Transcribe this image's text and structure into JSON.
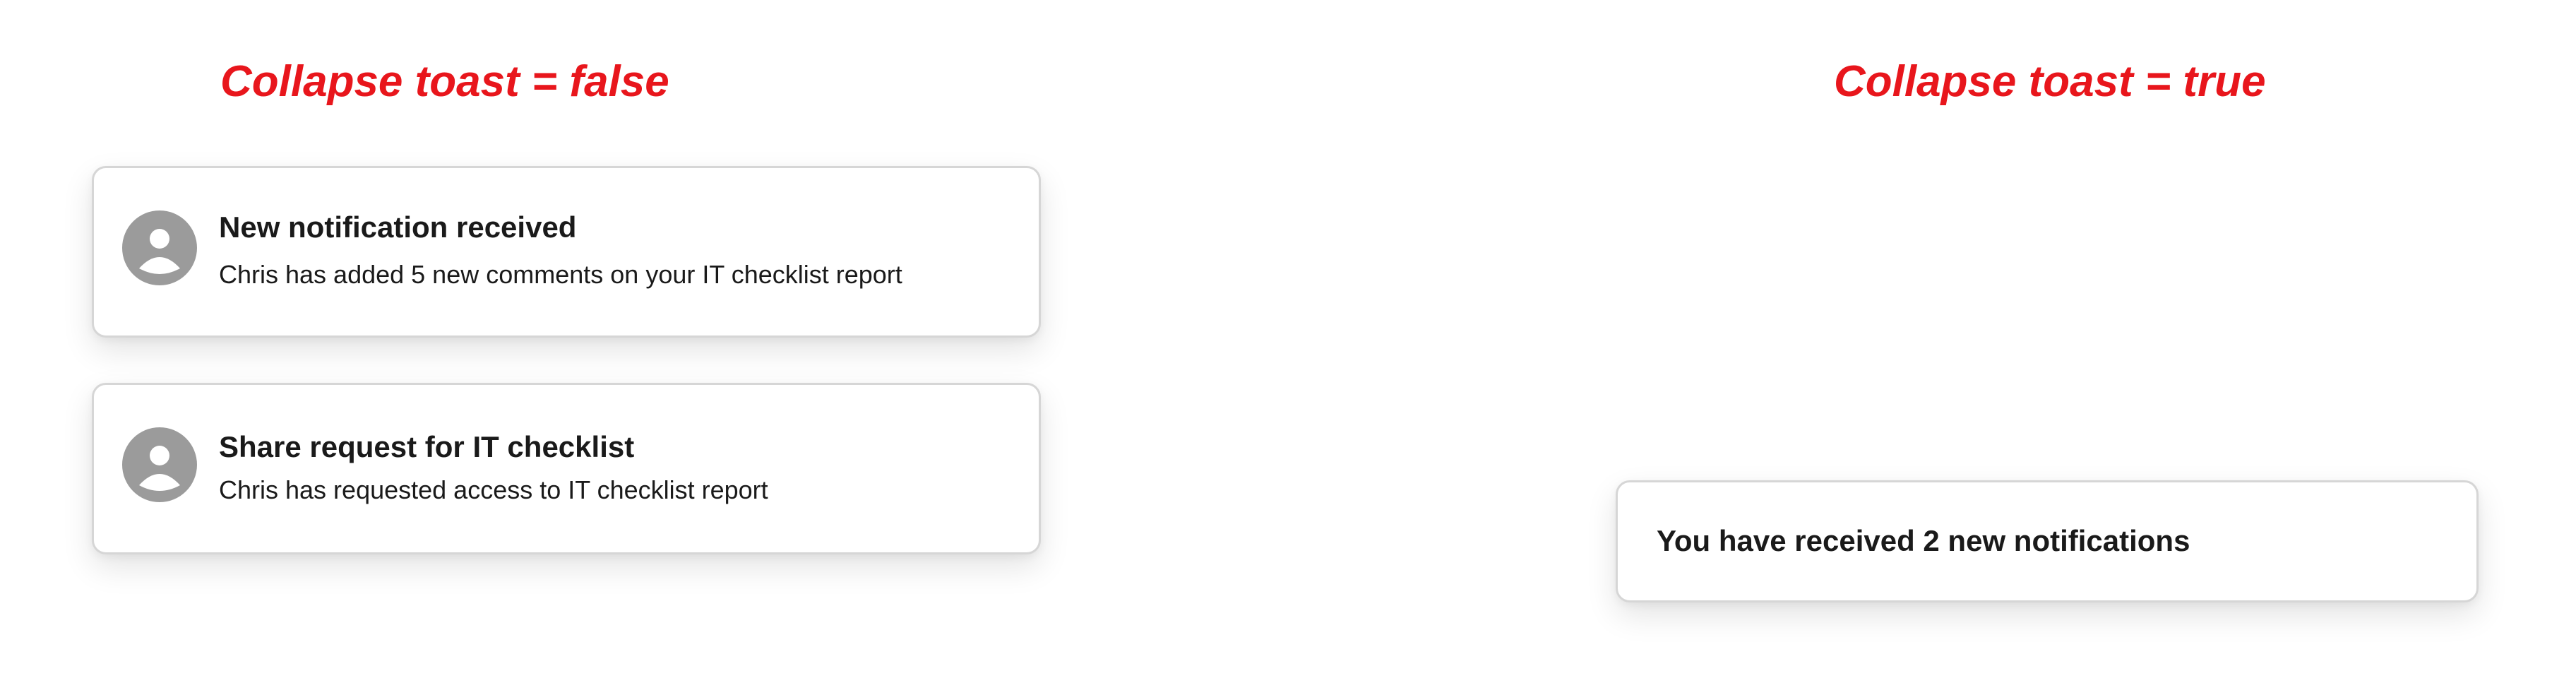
{
  "left_panel": {
    "heading": "Collapse toast = false",
    "toasts": [
      {
        "icon": "user-avatar-icon",
        "title": "New notification received",
        "body": "Chris has added 5 new comments on your IT checklist report"
      },
      {
        "icon": "user-avatar-icon",
        "title": "Share request for IT checklist",
        "body": "Chris has requested access to IT checklist report"
      }
    ]
  },
  "right_panel": {
    "heading": "Collapse toast = true",
    "collapsed_toast": {
      "text": "You have received 2 new notifications"
    }
  },
  "colors": {
    "heading": "#e8161c",
    "toast_border": "#d6d6d6",
    "avatar": "#9b9b9b",
    "text": "#1a1a1a"
  }
}
